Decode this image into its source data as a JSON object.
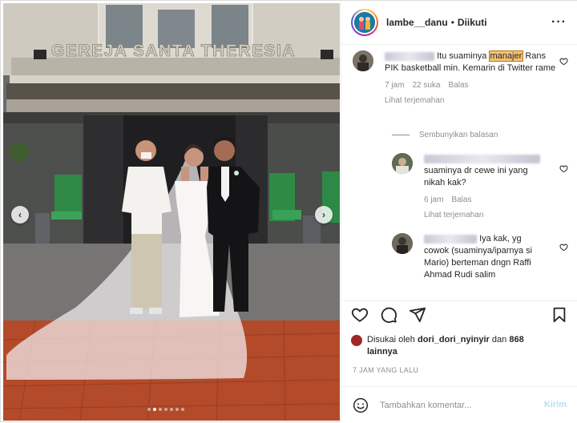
{
  "post": {
    "username": "lambe__danu",
    "separator": "•",
    "follow_state": "Diikuti",
    "more_icon": "more-horizontal-icon",
    "photo": {
      "church_sign": "GEREJA SANTA THERESIA",
      "carousel_dots": 7,
      "active_dot": 2
    }
  },
  "comments": {
    "c1": {
      "text_before": "Itu suaminya",
      "highlight": "manajer",
      "text_after": "Rans PIK basketball min. Kemarin di Twitter rame",
      "time": "7 jam",
      "likes": "22 suka",
      "reply": "Balas",
      "translate": "Lihat terjemahan"
    },
    "hide_replies": "Sembunyikan balasan",
    "r1": {
      "text": "suaminya dr cewe ini yang nikah kak?",
      "time": "6 jam",
      "reply": "Balas",
      "translate": "Lihat terjemahan"
    },
    "r2": {
      "text": "Iya kak, yg cowok (suaminya/iparnya si Mario) berteman dngn Raffi Ahmad Rudi salim"
    }
  },
  "actions": {
    "like_icon": "heart-icon",
    "comment_icon": "comment-icon",
    "share_icon": "send-icon",
    "save_icon": "bookmark-icon"
  },
  "likes": {
    "prefix": "Disukai oleh",
    "user": "dori_dori_nyinyir",
    "joiner": "dan",
    "count": "868 lainnya"
  },
  "time_ago": "7 JAM YANG LALU",
  "composer": {
    "placeholder": "Tambahkan komentar...",
    "post_label": "Kirim",
    "emoji_icon": "emoji-icon"
  },
  "colors": {
    "highlight": "#f6c273",
    "post_button": "#b2dffc",
    "muted_text": "#8e8e8e"
  }
}
